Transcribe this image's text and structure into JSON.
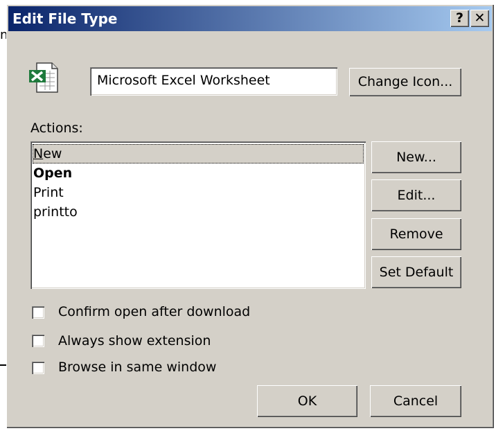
{
  "window": {
    "title": "Edit File Type",
    "help_button": "?",
    "close_button": "✕"
  },
  "edge_glyph": "n",
  "file_type": {
    "name": "Microsoft Excel Worksheet",
    "icon": "excel-worksheet-icon",
    "change_icon_label": "Change Icon..."
  },
  "actions": {
    "label": "Actions:",
    "items": [
      {
        "first": "N",
        "rest": "ew",
        "selected": true,
        "bold": false
      },
      {
        "first": "",
        "rest": "Open",
        "selected": false,
        "bold": true
      },
      {
        "first": "",
        "rest": "Print",
        "selected": false,
        "bold": false
      },
      {
        "first": "",
        "rest": "printto",
        "selected": false,
        "bold": false
      }
    ]
  },
  "action_buttons": {
    "new": "New...",
    "edit": "Edit...",
    "remove": "Remove",
    "set_default": "Set Default"
  },
  "options": [
    {
      "label": "Confirm open after download",
      "checked": false
    },
    {
      "label": "Always show extension",
      "checked": false
    },
    {
      "label": "Browse in same window",
      "checked": false
    }
  ],
  "footer": {
    "ok": "OK",
    "cancel": "Cancel"
  },
  "colors": {
    "titlebar_start": "#0a246a",
    "titlebar_end": "#a6caf0",
    "face": "#d4d0c8",
    "selection": "#d4d0c8"
  }
}
